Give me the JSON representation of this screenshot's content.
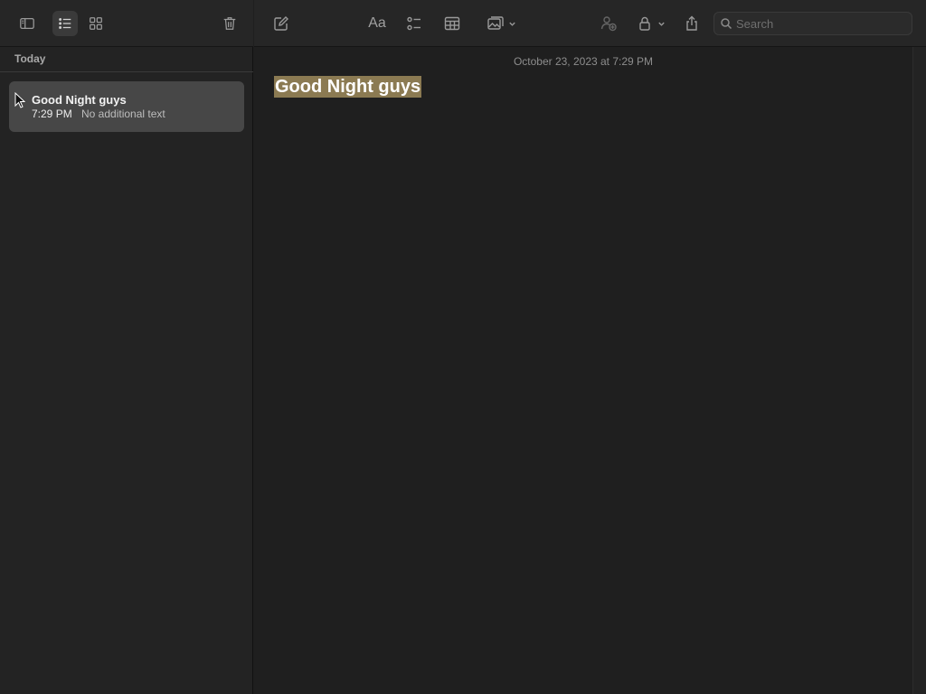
{
  "sidebar": {
    "section_header": "Today",
    "notes": [
      {
        "title": "Good Night guys",
        "time": "7:29 PM",
        "preview": "No additional text"
      }
    ]
  },
  "toolbar": {
    "icons": [
      "sidebar-toggle-icon",
      "list-view-icon",
      "gallery-view-icon",
      "trash-icon",
      "compose-icon",
      "text-format-icon",
      "checklist-icon",
      "table-icon",
      "media-icon",
      "collaborate-icon",
      "lock-icon",
      "share-icon",
      "search-icon"
    ],
    "format_label": "Aa",
    "search_placeholder": "Search"
  },
  "editor": {
    "date": "October 23, 2023 at 7:29 PM",
    "heading": "Good Night guys"
  },
  "colors": {
    "background": "#1f1f1f",
    "selected_note": "#474747",
    "highlight": "#8b7a52"
  }
}
